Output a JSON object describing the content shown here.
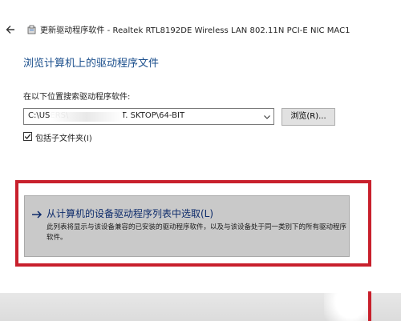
{
  "titlebar": {
    "back_icon": "back-arrow-icon",
    "app_icon": "driver-icon",
    "title": "更新驱动程序软件 - Realtek RTL8192DE Wireless LAN 802.11N PCI-E NIC MAC1"
  },
  "page": {
    "heading": "浏览计算机上的驱动程序文件",
    "search_label": "在以下位置搜索驱动程序软件:",
    "path_value_prefix": "C:\\USERS\\",
    "path_value_suffix": "T. SKTOP\\64-BIT",
    "browse_label": "浏览(R)...",
    "include_subfolders_label": "包括子文件夹(I)",
    "include_subfolders_checked": true
  },
  "pick_option": {
    "title": "从计算机的设备驱动程序列表中选取(L)",
    "description": "此列表将显示与该设备兼容的已安装的驱动程序软件，以及与该设备处于同一类别下的所有驱动程序软件。",
    "arrow_icon": "arrow-right-icon"
  },
  "colors": {
    "heading": "#1a4e8c",
    "highlight_frame": "#c8202c",
    "option_bg": "#c9c9c9",
    "option_title": "#0d2b6b"
  }
}
